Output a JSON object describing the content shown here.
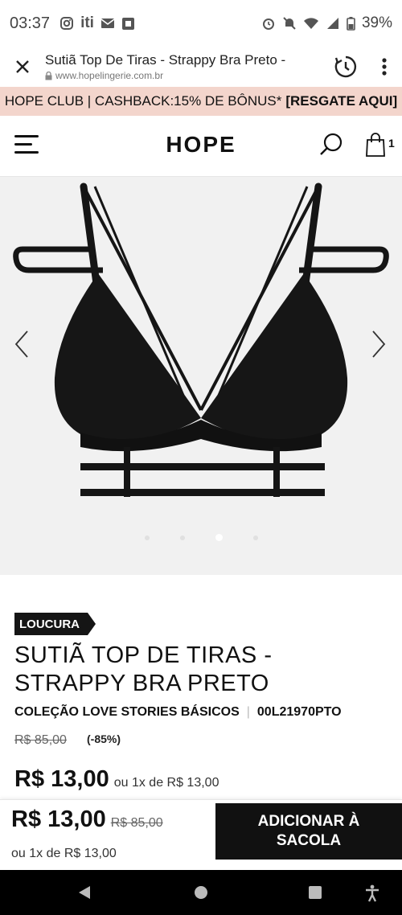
{
  "status_bar": {
    "time": "03:37",
    "left_icons": [
      "instagram-icon",
      "iti-icon",
      "mail-icon",
      "square-app-icon"
    ],
    "right_icons": [
      "alarm-icon",
      "mute-icon",
      "wifi-icon",
      "signal-icon",
      "battery-icon"
    ],
    "battery": "39%"
  },
  "browser": {
    "page_title": "Sutiã Top De Tiras - Strappy Bra Preto -",
    "url": "www.hopelingerie.com.br"
  },
  "promo": {
    "text": "HOPE CLUB | CASHBACK:15% DE BÔNUS*",
    "cta": "[RESGATE AQUI]"
  },
  "header": {
    "logo": "HOPE",
    "bag_count": "1"
  },
  "gallery": {
    "image_count": 4,
    "active_index": 2
  },
  "product": {
    "tag": "LOUCURA",
    "name": "SUTIÃ TOP DE TIRAS - STRAPPY BRA PRETO",
    "collection": "COLEÇÃO LOVE STORIES BÁSICOS",
    "sku": "00L21970PTO",
    "old_price": "R$ 85,00",
    "discount": "(-85%)",
    "price": "R$ 13,00",
    "installment": "ou  1x de  R$ 13,00"
  },
  "sticky": {
    "price": "R$ 13,00",
    "old_price": "R$ 85,00",
    "installment": "ou  1x de  R$ 13,00",
    "cta": "ADICIONAR À SACOLA"
  },
  "colors": {
    "promo_bg": "#f3d5cc",
    "dark": "#111111",
    "gallery_bg": "#f1f1f1"
  }
}
